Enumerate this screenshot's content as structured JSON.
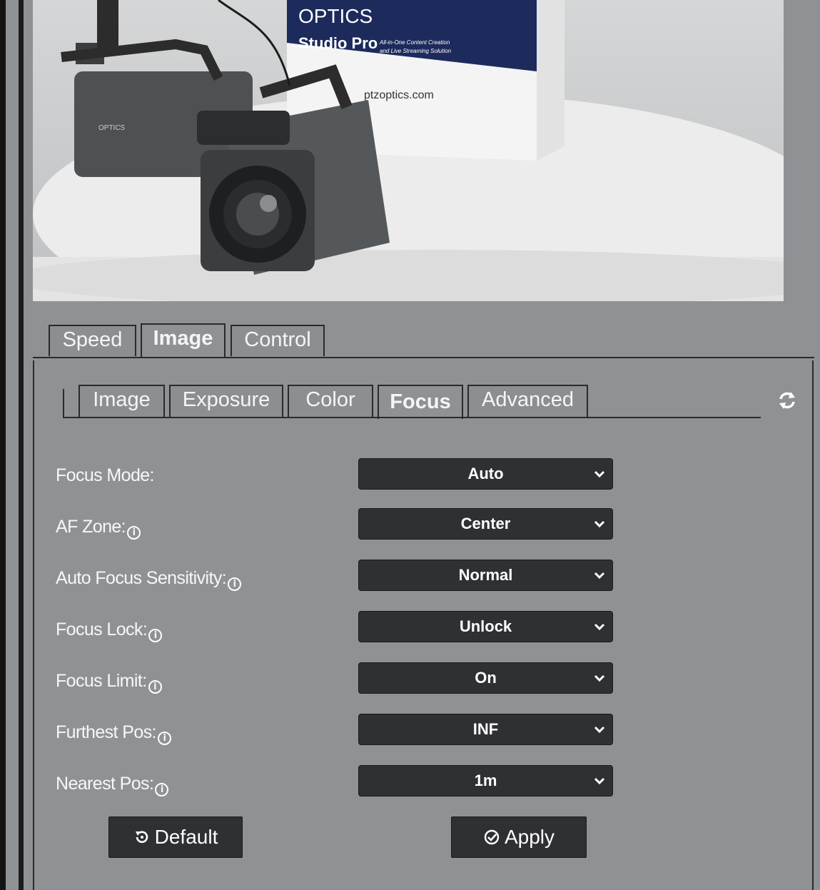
{
  "preview": {
    "box_brand": "OPTICS",
    "box_product": "Studio Pro",
    "box_tagline_1": "All-in-One Content Creation",
    "box_tagline_2": "and Live Streaming Solution",
    "box_url": "ptzoptics.com",
    "camera_brand": "OPTICS"
  },
  "main_tabs": [
    {
      "label": "Speed",
      "active": false
    },
    {
      "label": "Image",
      "active": true
    },
    {
      "label": "Control",
      "active": false
    }
  ],
  "sub_tabs": [
    {
      "label": "Image",
      "active": false
    },
    {
      "label": "Exposure",
      "active": false
    },
    {
      "label": "Color",
      "active": false
    },
    {
      "label": "Focus",
      "active": true
    },
    {
      "label": "Advanced",
      "active": false
    }
  ],
  "refresh_icon": "refresh-icon",
  "fields": [
    {
      "label": "Focus Mode:",
      "info": false,
      "value": "Auto"
    },
    {
      "label": "AF Zone:",
      "info": true,
      "value": "Center"
    },
    {
      "label": "Auto Focus Sensitivity:",
      "info": true,
      "value": "Normal"
    },
    {
      "label": "Focus Lock:",
      "info": true,
      "value": "Unlock"
    },
    {
      "label": "Focus Limit:",
      "info": true,
      "value": "On"
    },
    {
      "label": "Furthest Pos:",
      "info": true,
      "value": "INF"
    },
    {
      "label": "Nearest Pos:",
      "info": true,
      "value": "1m"
    }
  ],
  "info_glyph": "i",
  "buttons": {
    "default_label": "Default",
    "default_icon": "reset-icon",
    "apply_label": "Apply",
    "apply_icon": "check-circle-icon"
  },
  "colors": {
    "background": "#8f9295",
    "control_dark": "#2f3033",
    "border": "#2a2a2a"
  }
}
